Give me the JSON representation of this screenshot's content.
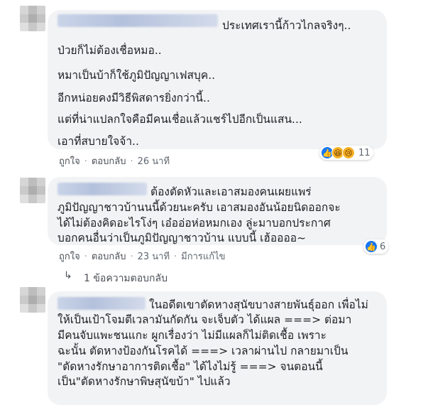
{
  "comments": [
    {
      "lines": [
        "ประเทศเรานี้ก้าวไกลจริงๆ..",
        "ป่วยก็ไม่ต้องเชื่อหมอ..",
        "หมาเป็นบ้าก็ใช้ภูมิปัญญาเฟสบุค..",
        "อีกหน่อยคงมีวิธีพิสดารยิ่งกว่านี้..",
        "แต่ที่น่าแปลกใจคือมีคนเชื่อแล้วแชร์ไปอีกเป็นแสน...",
        "เอาที่สบายใจจ้า.."
      ],
      "like_label": "ถูกใจ",
      "reply_label": "ตอบกลับ",
      "time": "26 นาที",
      "reaction_icons": [
        "like-icon",
        "haha-icon",
        "sad-icon"
      ],
      "reaction_count": "11"
    },
    {
      "lines": [
        "ต้องตัดหัวและเอาสมองคนเผยแพร่",
        "ภูมิปัญญาชาวบ้านนนี้ด้วยนะครับ เอาสมองอันน้อยนิดออกจะ",
        "ได้ไม่ต้องคิดอะไรโง่ๆ เอ๋ออ่อห่อหมกเอง ลู่ะมาบอกประกาศ",
        "บอกคนอื่นว่าเป็นภูมิปัญญาชาวบ้าน แบบนี้ เฮ้ออออ~"
      ],
      "like_label": "ถูกใจ",
      "reply_label": "ตอบกลับ",
      "time": "23 นาที",
      "edited": "มีการแก้ไข",
      "reaction_icons": [
        "like-icon"
      ],
      "reaction_count": "6"
    },
    {
      "lines": [
        "ในอดีตเขาตัดหางสุนัขบางสายพันธุ์ออก เพื่อไม่",
        "ให้เป็นเป้าโจมตีเวลามันกัดกัน จะเจ็บตัว ได้แผล ===> ต่อมา",
        "มีคนจับแพะชนแกะ ผูกเรื่องว่า ไม่มีแผลก็ไม่ติดเชื้อ เพราะ",
        "ฉะนั้น ตัดหางป้องกันโรคได้ ===> เวลาผ่านไป กลายมาเป็น",
        "\"ตัดหางรักษาอาการติดเชื้อ\" ได้ไงไม่รู้ ===> จนตอนนี้",
        "เป็น\"ตัดหางรักษาพิษสุนัขบ้า\" ไปแล้ว"
      ]
    }
  ],
  "replies_link": "1 ข้อความตอบกลับ",
  "colors": {
    "bubble": "#f2f3f5",
    "meta": "#606770",
    "like_blue": "#1877f2"
  }
}
